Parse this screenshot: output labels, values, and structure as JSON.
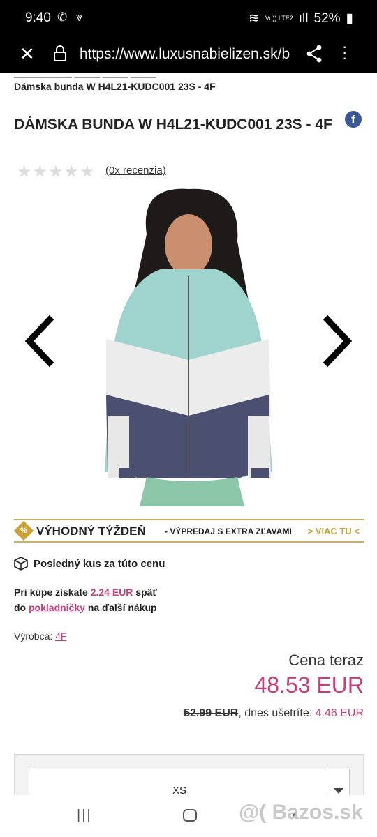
{
  "status_bar": {
    "time": "9:40",
    "network": "Vo)) LTE2",
    "battery": "52%"
  },
  "browser": {
    "url": "https://www.luxusnabielizen.sk/b"
  },
  "breadcrumb": "Dámska bunda W H4L21-KUDC001 23S - 4F",
  "product": {
    "title": "DÁMSKA BUNDA W H4L21-KUDC001 23S - 4F",
    "rating_stars": 0,
    "reviews_link": "(0x recenzia)"
  },
  "promo": {
    "badge": "%",
    "headline": "VÝHODNÝ TÝŽDEŇ",
    "subline": "- VÝPREDAJ S EXTRA ZĽAVAMI",
    "more": "> VIAC TU <"
  },
  "stock": {
    "text": "Posledný kus za túto cenu"
  },
  "cashback": {
    "line1_prefix": "Pri kúpe získate",
    "amount": "2.24 EUR",
    "line1_suffix": "späť",
    "line2_prefix": "do",
    "link": "pokladničky",
    "line2_suffix": "na ďalší nákup"
  },
  "manufacturer": {
    "label": "Výrobca:",
    "value": "4F"
  },
  "pricing": {
    "label": "Cena teraz",
    "current": "48.53 EUR",
    "old": "52.99 EUR",
    "savings_label": ", dnes ušetríte:",
    "savings": "4.46 EUR"
  },
  "size_select": {
    "value": "XS"
  },
  "watermark": "@( Bazos.sk",
  "colors": {
    "accent_pink": "#c93e7a",
    "gold": "#c9a23a",
    "facebook": "#3b5998"
  }
}
